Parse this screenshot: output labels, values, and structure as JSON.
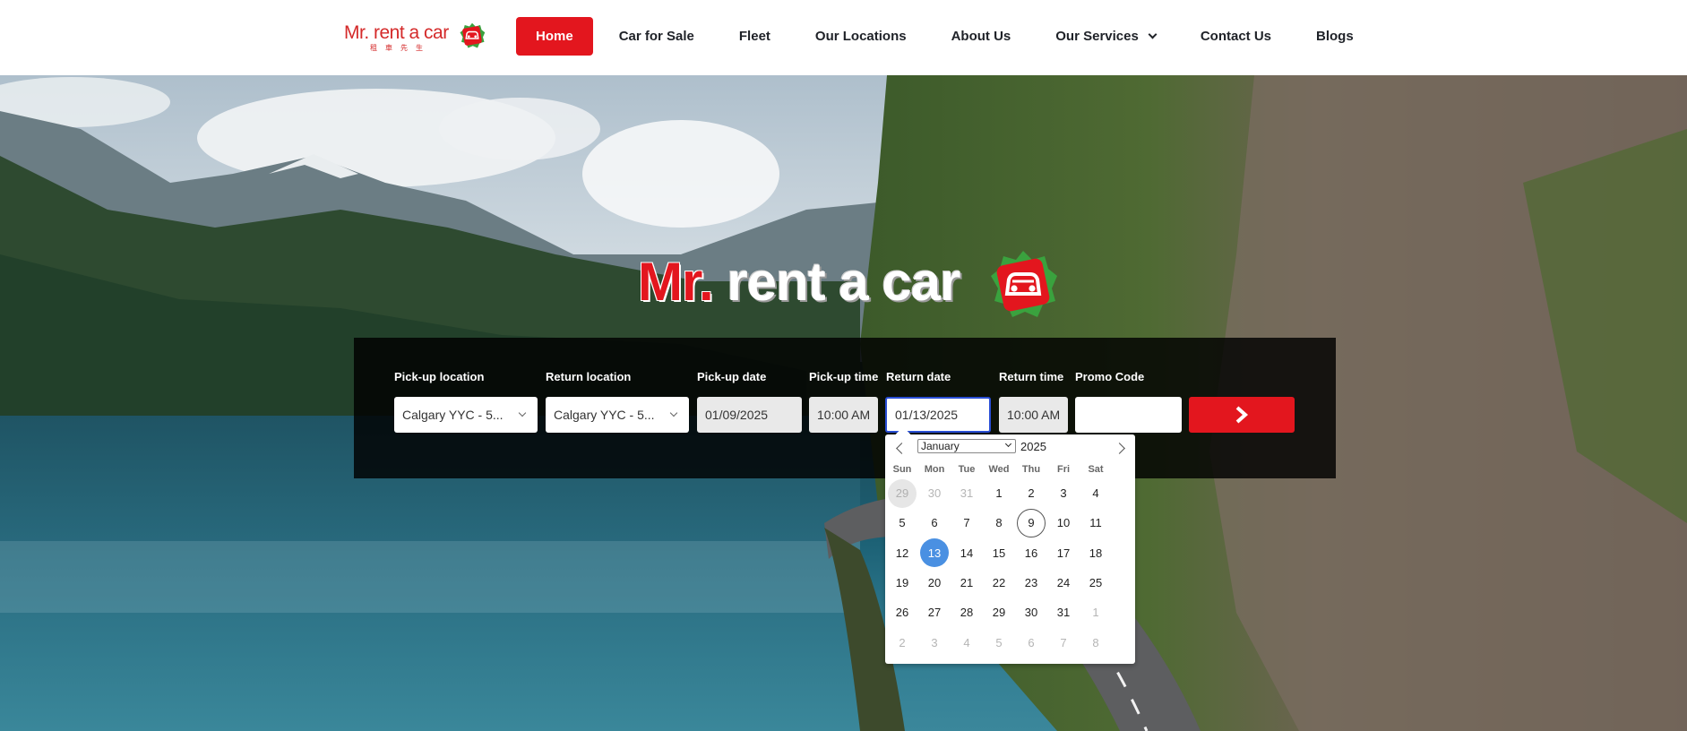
{
  "header": {
    "logo_text": "Mr. rent a car",
    "logo_subtext": "租車先生",
    "nav": [
      {
        "label": "Home",
        "active": true
      },
      {
        "label": "Car for Sale"
      },
      {
        "label": "Fleet"
      },
      {
        "label": "Our Locations"
      },
      {
        "label": "About Us"
      },
      {
        "label": "Our Services",
        "dropdown": true
      },
      {
        "label": "Contact Us"
      },
      {
        "label": "Blogs"
      }
    ]
  },
  "hero": {
    "logo_mr": "Mr.",
    "logo_rest": " rent a car"
  },
  "booking": {
    "pickup_location_label": "Pick-up location",
    "pickup_location_value": "Calgary YYC - 5...",
    "return_location_label": "Return location",
    "return_location_value": "Calgary YYC - 5...",
    "pickup_date_label": "Pick-up date",
    "pickup_date_value": "01/09/2025",
    "pickup_time_label": "Pick-up time",
    "pickup_time_value": "10:00 AM",
    "return_date_label": "Return date",
    "return_date_value": "01/13/2025",
    "return_time_label": "Return time",
    "return_time_value": "10:00 AM",
    "promo_label": "Promo Code",
    "promo_value": "",
    "submit_icon": "chevron-right-icon"
  },
  "datepicker": {
    "month": "January",
    "year": "2025",
    "weekdays": [
      "Sun",
      "Mon",
      "Tue",
      "Wed",
      "Thu",
      "Fri",
      "Sat"
    ],
    "weeks": [
      [
        "29",
        "30",
        "31",
        "1",
        "2",
        "3",
        "4"
      ],
      [
        "5",
        "6",
        "7",
        "8",
        "9",
        "10",
        "11"
      ],
      [
        "12",
        "13",
        "14",
        "15",
        "16",
        "17",
        "18"
      ],
      [
        "19",
        "20",
        "21",
        "22",
        "23",
        "24",
        "25"
      ],
      [
        "26",
        "27",
        "28",
        "29",
        "30",
        "31",
        "1"
      ],
      [
        "2",
        "3",
        "4",
        "5",
        "6",
        "7",
        "8"
      ]
    ],
    "today": "9",
    "selected": "13"
  },
  "colors": {
    "brand_red": "#e3161e",
    "selected_blue": "#4a90e2",
    "focus_border": "#2a4fd6"
  }
}
